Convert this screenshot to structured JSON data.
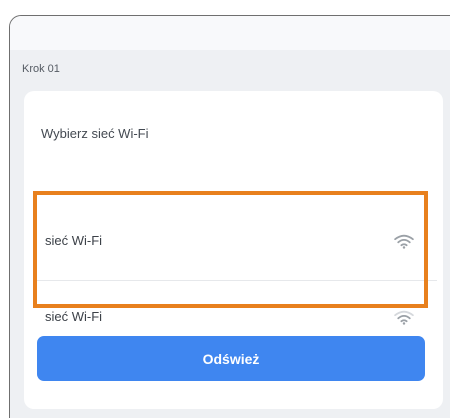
{
  "step": {
    "label": "Krok 01"
  },
  "card": {
    "title": "Wybierz sieć Wi-Fi"
  },
  "networks": [
    {
      "name": "sieć Wi-Fi",
      "icon": "wifi-icon"
    },
    {
      "name": "sieć Wi-Fi",
      "icon": "wifi-icon"
    }
  ],
  "actions": {
    "refresh_label": "Odśwież"
  },
  "colors": {
    "accent": "#3f86f0",
    "highlight": "#e8801d",
    "background": "#eef0f3"
  }
}
